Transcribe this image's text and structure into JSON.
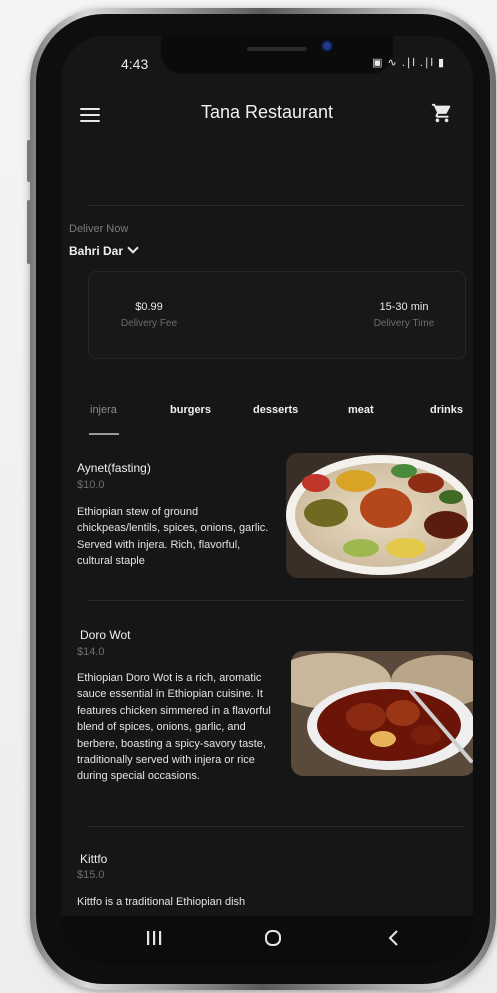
{
  "status": {
    "time": "4:43",
    "icons_text": "▣ ∿ .∣l .∣l ▮"
  },
  "appbar": {
    "title": "Tana Restaurant",
    "menu_icon": "hamburger-menu-icon",
    "cart_icon": "shopping-cart-icon"
  },
  "delivery": {
    "label": "Deliver Now",
    "location": "Bahri Dar"
  },
  "info": {
    "fee_value": "$0.99",
    "fee_caption": "Delivery Fee",
    "time_value": "15-30 min",
    "time_caption": "Delivery Time"
  },
  "tabs": [
    {
      "label": "injera",
      "active": true
    },
    {
      "label": "burgers",
      "active": false
    },
    {
      "label": "desserts",
      "active": false
    },
    {
      "label": "meat",
      "active": false
    },
    {
      "label": "drinks",
      "active": false
    }
  ],
  "items": [
    {
      "name": "Aynet(fasting)",
      "price": "$10.0",
      "description": "Ethiopian stew of ground chickpeas/lentils, spices, onions, garlic. Served with injera. Rich, flavorful, cultural staple"
    },
    {
      "name": "Doro Wot",
      "price": "$14.0",
      "description": "Ethiopian Doro Wot is a rich, aromatic sauce essential in Ethiopian cuisine. It features chicken simmered in a flavorful blend of spices, onions, garlic, and berbere, boasting a spicy-savory taste, traditionally served with injera or rice during special occasions."
    },
    {
      "name": "Kittfo",
      "price": "$15.0",
      "description": "Kittfo is a traditional Ethiopian dish"
    }
  ],
  "navbar": {
    "recent_icon": "recent-apps-icon",
    "home_icon": "home-icon",
    "back_icon": "back-icon"
  },
  "colors": {
    "background": "#161616",
    "text": "#e6e6e6",
    "muted": "#6e6e6e"
  }
}
